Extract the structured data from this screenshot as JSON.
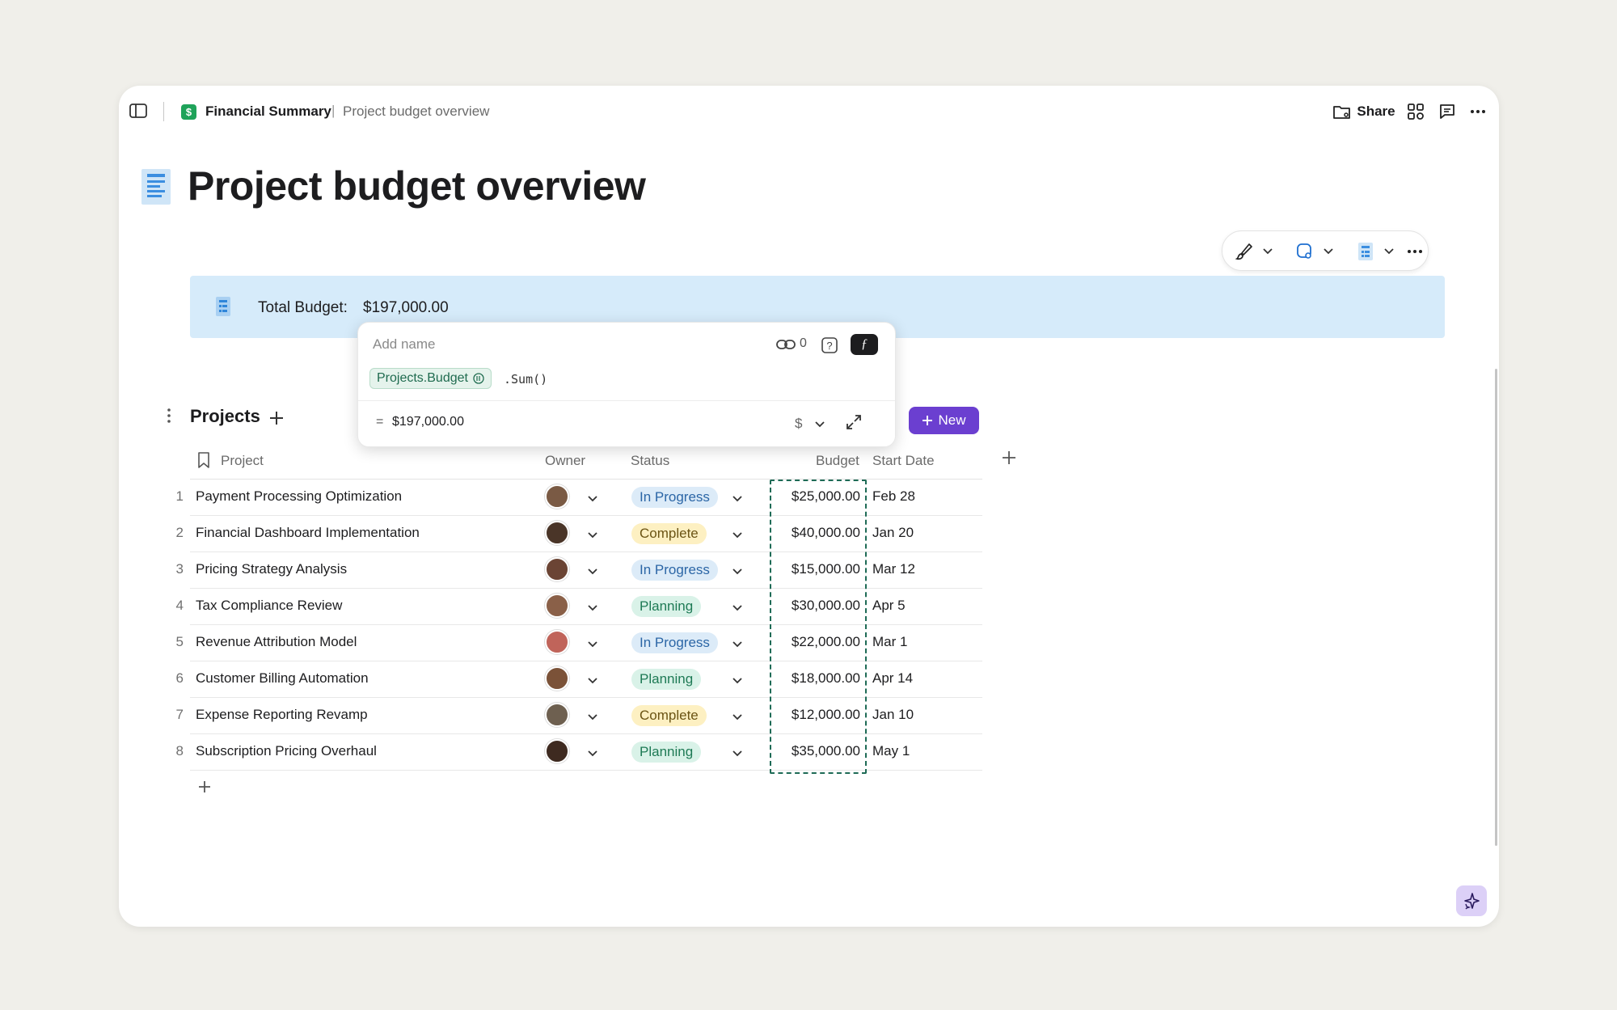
{
  "breadcrumb": {
    "doc_name": "Financial Summary",
    "separator": "|",
    "page_name": "Project budget overview"
  },
  "topbar": {
    "share_label": "Share"
  },
  "page": {
    "title": "Project budget overview"
  },
  "callout": {
    "label": "Total Budget:",
    "value": "$197,000.00"
  },
  "formula_popup": {
    "name_placeholder": "Add name",
    "link_count": "0",
    "formula_chip": "Projects.Budget",
    "formula_rest": ".Sum()",
    "result_prefix": "=",
    "result_value": "$197,000.00",
    "format_symbol": "$"
  },
  "table": {
    "title": "Projects",
    "new_button_label": "New",
    "columns": {
      "project": "Project",
      "owner": "Owner",
      "status": "Status",
      "budget": "Budget",
      "start_date": "Start Date"
    },
    "rows": [
      {
        "num": "1",
        "project": "Payment Processing Optimization",
        "status": "In Progress",
        "status_kind": "progress",
        "budget": "$25,000.00",
        "start_date": "Feb 28",
        "avatar_color": "#7a5a44"
      },
      {
        "num": "2",
        "project": "Financial Dashboard Implementation",
        "status": "Complete",
        "status_kind": "complete",
        "budget": "$40,000.00",
        "start_date": "Jan 20",
        "avatar_color": "#4a3528"
      },
      {
        "num": "3",
        "project": "Pricing Strategy Analysis",
        "status": "In Progress",
        "status_kind": "progress",
        "budget": "$15,000.00",
        "start_date": "Mar 12",
        "avatar_color": "#6b4434"
      },
      {
        "num": "4",
        "project": "Tax Compliance Review",
        "status": "Planning",
        "status_kind": "planning",
        "budget": "$30,000.00",
        "start_date": "Apr 5",
        "avatar_color": "#8a6048"
      },
      {
        "num": "5",
        "project": "Revenue Attribution Model",
        "status": "In Progress",
        "status_kind": "progress",
        "budget": "$22,000.00",
        "start_date": "Mar 1",
        "avatar_color": "#c0645a"
      },
      {
        "num": "6",
        "project": "Customer Billing Automation",
        "status": "Planning",
        "status_kind": "planning",
        "budget": "$18,000.00",
        "start_date": "Apr 14",
        "avatar_color": "#7b5238"
      },
      {
        "num": "7",
        "project": "Expense Reporting Revamp",
        "status": "Complete",
        "status_kind": "complete",
        "budget": "$12,000.00",
        "start_date": "Jan 10",
        "avatar_color": "#6e6050"
      },
      {
        "num": "8",
        "project": "Subscription Pricing Overhaul",
        "status": "Planning",
        "status_kind": "planning",
        "budget": "$35,000.00",
        "start_date": "May 1",
        "avatar_color": "#3e2a20"
      }
    ]
  },
  "colors": {
    "accent_purple": "#6b3fd0",
    "callout_bg": "#d6ebfa",
    "selection_green": "#1e6b56",
    "doc_icon_green": "#1fa35a"
  },
  "icons": [
    "sidebar-toggle-icon",
    "doc-icon",
    "share-folder-icon",
    "apps-icon",
    "comment-icon",
    "more-icon",
    "page-icon",
    "brush-icon",
    "shape-icon",
    "calculator-icon",
    "link-icon",
    "help-icon",
    "formula-icon",
    "expand-icon",
    "bookmark-icon",
    "plus-icon",
    "sparkle-icon"
  ]
}
